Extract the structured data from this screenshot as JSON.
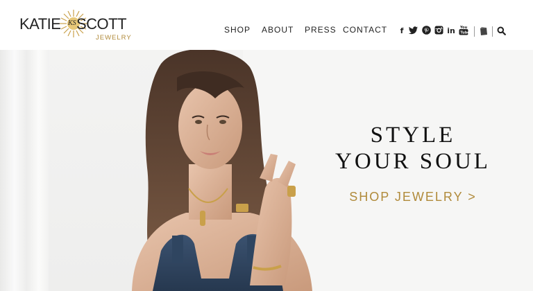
{
  "brand": {
    "name": "KATIE SCOTT",
    "left_word": "KATIE",
    "right_word": "SCOTT",
    "monogram": "KS",
    "sub": "JEWELRY",
    "accent_color": "#b08a3a"
  },
  "nav": {
    "items": [
      "SHOP",
      "ABOUT",
      "PRESS",
      "CONTACT"
    ]
  },
  "social": {
    "icons": [
      "facebook-icon",
      "twitter-icon",
      "pinterest-icon",
      "instagram-icon",
      "linkedin-icon",
      "youtube-icon",
      "bag-icon",
      "search-icon"
    ]
  },
  "hero": {
    "headline_line1": "STYLE",
    "headline_line2": "YOUR SOUL",
    "cta": "SHOP JEWELRY >"
  }
}
